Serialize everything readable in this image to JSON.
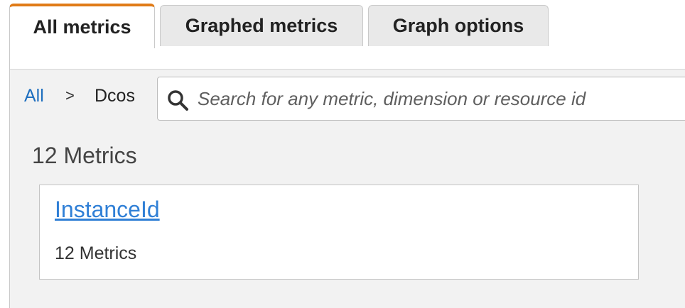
{
  "tabs": [
    {
      "label": "All metrics",
      "active": true
    },
    {
      "label": "Graphed metrics",
      "active": false
    },
    {
      "label": "Graph options",
      "active": false
    }
  ],
  "breadcrumb": {
    "root": "All",
    "separator": ">",
    "current": "Dcos"
  },
  "search": {
    "placeholder": "Search for any metric, dimension or resource id",
    "value": ""
  },
  "metrics_summary": "12 Metrics",
  "dimension_card": {
    "title": "InstanceId",
    "subtitle": "12 Metrics"
  },
  "colors": {
    "active_tab_accent": "#e07b17",
    "link": "#2f7fd6",
    "breadcrumb_link": "#1f6fbf",
    "panel_background": "#f2f2f2"
  },
  "icons": {
    "search": "search-icon"
  }
}
